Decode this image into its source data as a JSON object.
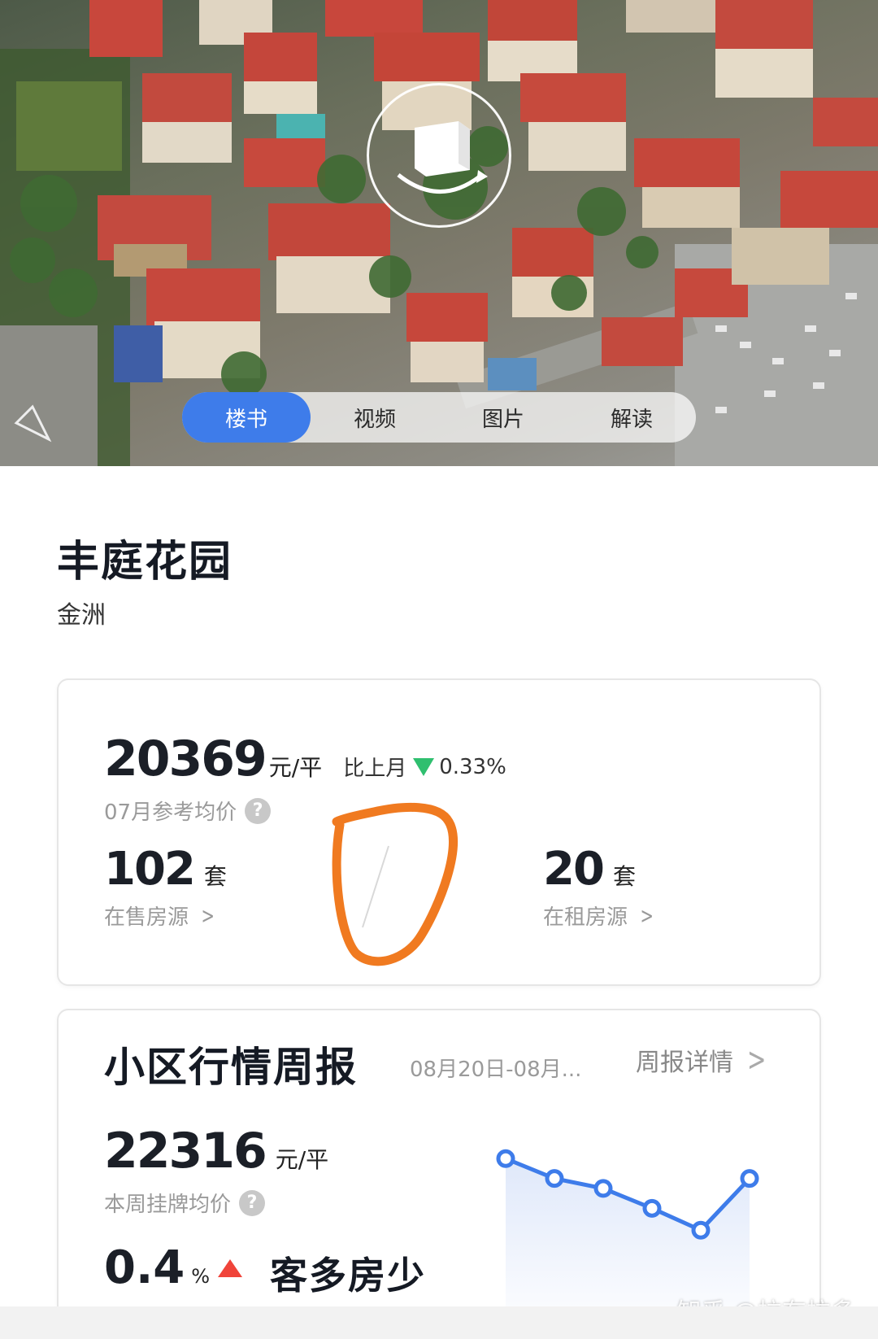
{
  "hero": {
    "tabs": [
      {
        "label": "楼书",
        "active": true
      },
      {
        "label": "视频",
        "active": false
      },
      {
        "label": "图片",
        "active": false
      },
      {
        "label": "解读",
        "active": false
      }
    ]
  },
  "community": {
    "name": "丰庭花园",
    "district": "金洲"
  },
  "overview": {
    "price": "20369",
    "price_unit": "元/平",
    "compare_label": "比上月",
    "change": "0.33%",
    "change_direction": "down",
    "price_label": "07月参考均价",
    "for_sale_count": "102",
    "for_sale_unit": "套",
    "for_sale_label": "在售房源",
    "for_rent_count": "20",
    "for_rent_unit": "套",
    "for_rent_label": "在租房源"
  },
  "weekly": {
    "title": "小区行情周报",
    "date_range": "08月20日-08月...",
    "detail_label": "周报详情",
    "listing_price": "22316",
    "listing_unit": "元/平",
    "listing_label": "本周挂牌均价",
    "ratio": "0.4",
    "ratio_unit": "%",
    "ratio_direction": "up",
    "market_status": "客多房少",
    "trend_points": [
      6,
      5,
      4.5,
      3.5,
      2.4,
      5
    ]
  },
  "watermark": "知乎 @拉布拉多",
  "colors": {
    "accent": "#3e7cea",
    "down": "#2fbf6f",
    "up": "#f0443a",
    "annotation": "#f07a20"
  }
}
